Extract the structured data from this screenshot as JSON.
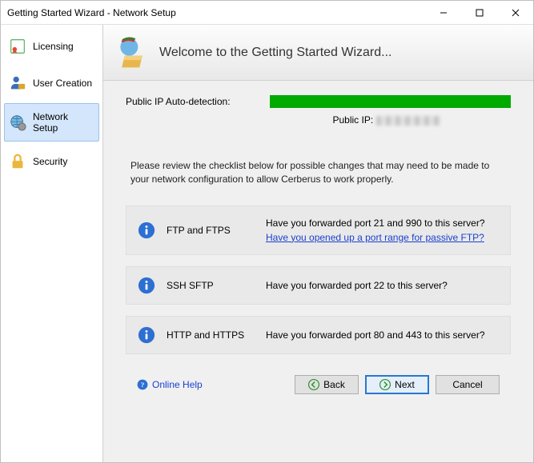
{
  "window": {
    "title": "Getting Started Wizard - Network Setup"
  },
  "sidebar": {
    "items": [
      {
        "label": "Licensing"
      },
      {
        "label": "User Creation"
      },
      {
        "label": "Network Setup"
      },
      {
        "label": "Security"
      }
    ]
  },
  "banner": {
    "title": "Welcome to the Getting Started Wizard..."
  },
  "ip": {
    "label": "Public IP Auto-detection:",
    "public_ip_label": "Public IP:"
  },
  "instructions": "Please review the checklist below for possible changes that may need to be made to your network configuration to allow Cerberus to work properly.",
  "checks": [
    {
      "name": "FTP and FTPS",
      "line1": "Have you forwarded port 21 and 990 to this server?",
      "link": "Have you opened up a port range for passive FTP?"
    },
    {
      "name": "SSH SFTP",
      "line1": "Have you forwarded port 22 to this server?"
    },
    {
      "name": "HTTP and HTTPS",
      "line1": "Have you forwarded port 80 and 443 to this server?"
    }
  ],
  "footer": {
    "online_help": "Online Help",
    "back": "Back",
    "next": "Next",
    "cancel": "Cancel"
  },
  "colors": {
    "progress": "#11a611",
    "link": "#1a3fcf",
    "selected_bg": "#d4e6fb"
  }
}
